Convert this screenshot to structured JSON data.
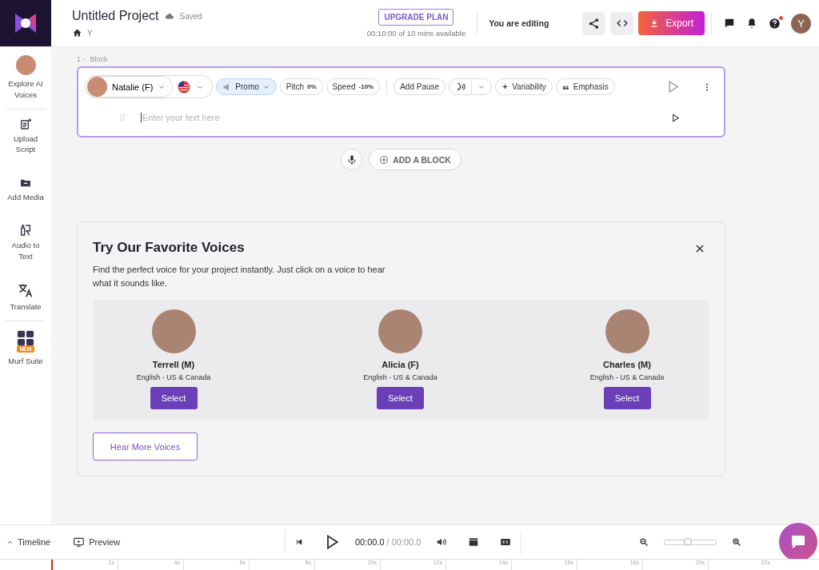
{
  "header": {
    "project_title": "Untitled Project",
    "save_status": "Saved",
    "breadcrumb": "Y",
    "upgrade_button": "UPGRADE PLAN",
    "time_available": "00:10:00 of 10 mins available",
    "editing_status": "You are editing",
    "export_button": "Export",
    "avatar_initial": "Y",
    "help_notification": true
  },
  "sidebar": {
    "items": [
      {
        "kind": "avatar",
        "label": "Explore AI Voices"
      },
      {
        "kind": "upload",
        "label": "Upload Script"
      },
      {
        "kind": "media",
        "label": "Add Media"
      },
      {
        "kind": "transcribe",
        "label": "Audio to Text"
      },
      {
        "kind": "translate",
        "label": "Translate"
      },
      {
        "kind": "suite",
        "label": "Murf Suite",
        "badge": "NEW"
      }
    ]
  },
  "block": {
    "number": "1 -",
    "label": "Block",
    "voice": "Natalie (F)",
    "style": "Promo",
    "pitch_label": "Pitch",
    "pitch": "0%",
    "speed_label": "Speed",
    "speed": "-10%",
    "add_pause": "Add Pause",
    "variability": "Variability",
    "emphasis": "Emphasis",
    "text_placeholder": "Enter your text here"
  },
  "add_block_button": "ADD A BLOCK",
  "favorites": {
    "title": "Try Our Favorite Voices",
    "description": "Find the perfect voice for your project instantly. Just click on a voice to hear what it sounds like.",
    "voices": [
      {
        "name": "Terrell (M)",
        "language": "English - US & Canada",
        "button": "Select"
      },
      {
        "name": "Alicia (F)",
        "language": "English - US & Canada",
        "button": "Select"
      },
      {
        "name": "Charles (M)",
        "language": "English - US & Canada",
        "button": "Select"
      }
    ],
    "more_button": "Hear More Voices"
  },
  "bottom_bar": {
    "timeline": "Timeline",
    "preview": "Preview",
    "current_time": "00:00.0",
    "separator": "/",
    "total_time": "00:00.0",
    "zoom": {
      "level": 0.45
    },
    "ruler": [
      "2s",
      "4s",
      "6s",
      "8s",
      "10s",
      "12s",
      "14s",
      "16s",
      "18s",
      "20s",
      "22s"
    ]
  }
}
